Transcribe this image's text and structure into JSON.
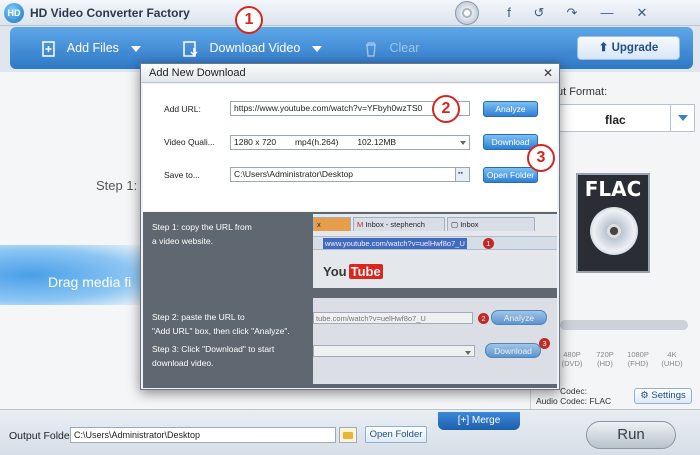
{
  "app": {
    "logo_text": "HD",
    "title": "HD Video Converter Factory"
  },
  "titlebar_icons": [
    "disc-icon",
    "facebook-icon",
    "undo-icon",
    "redo-icon",
    "minimize-icon",
    "close-icon"
  ],
  "titlebar_glyphs": {
    "facebook": "f",
    "undo": "↺",
    "redo": "↷",
    "minimize": "—",
    "close": "✕"
  },
  "toolbar": {
    "add_files": "Add Files",
    "download_video": "Download Video",
    "clear": "Clear",
    "upgrade": "Upgrade"
  },
  "main": {
    "step_label": "Step 1:",
    "drag_text": "Drag media fi"
  },
  "right_panel": {
    "output_format_label": "ut Format:",
    "format_value": "flac",
    "flac_label": "FLAC",
    "resolutions": [
      "480P\n(DVD)",
      "720P\n(HD)",
      "1080P\n(FHD)",
      "4K\n(UHD)"
    ],
    "video_codec": "Codec:",
    "audio_codec": "Audio Codec: FLAC",
    "settings": "Settings"
  },
  "bottom": {
    "output_folder_label": "Output Folder:",
    "output_folder_path": "C:\\Users\\Administrator\\Desktop",
    "open_folder": "Open Folder",
    "merge": "Merge",
    "run": "Run"
  },
  "dialog": {
    "title": "Add New Download",
    "close": "✕",
    "add_url_label": "Add URL:",
    "url_value": "https://www.youtube.com/watch?v=YFbyh0wzTS0",
    "analyze": "Analyze",
    "quality_label": "Video Quali...",
    "quality_value": "1280 x 720        mp4(h.264)        102.12MB",
    "download": "Download",
    "save_label": "Save to...",
    "save_path": "C:\\Users\\Administrator\\Desktop",
    "open_folder": "Open Folder",
    "step1_text": "Step 1: copy the URL from\na video website.",
    "step2_text": "Step 2: paste the URL to\n\"Add URL\" box, then click \"Analyze\".",
    "step3_text": "Step 3: Click \"Download\" to start\ndownload video.",
    "browser": {
      "tab_a": "x",
      "tab_b": "Inbox - stephench",
      "tab_c": "Inbox",
      "url_highlight": "www.youtube.com/watch?v=uelHwf8o7_U",
      "youtube_you": "You",
      "youtube_tube": "Tube"
    },
    "step2_url": "tube.com/watch?v=uelHwf8o7_U",
    "step2_analyze": "Analyze",
    "step3_download": "Download"
  },
  "callouts": {
    "one": "1",
    "two": "2",
    "three": "3"
  },
  "mini_badges": {
    "one": "1",
    "two": "2",
    "three": "3"
  }
}
